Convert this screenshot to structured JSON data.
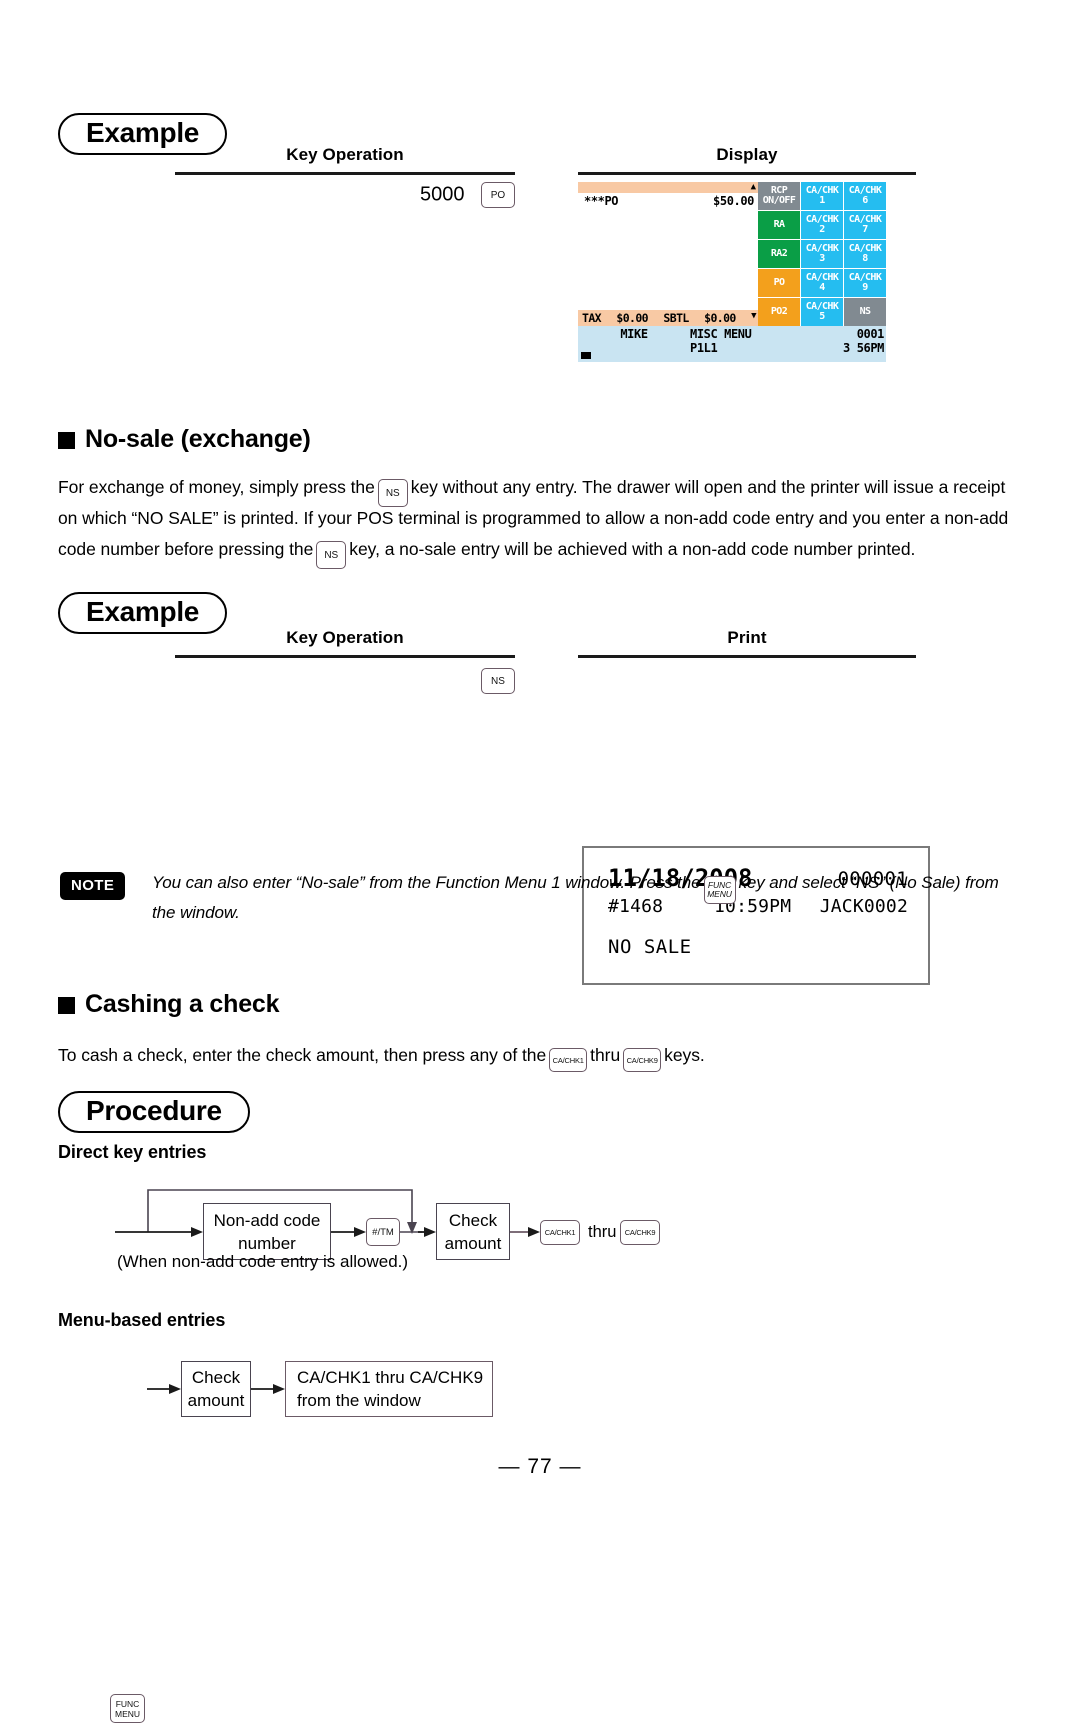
{
  "example1": {
    "pill_label": "Example",
    "key_operation_header": "Key Operation",
    "display_header": "Display",
    "entry_amount": "5000",
    "entry_key": "PO"
  },
  "pos_display": {
    "item_label": "***PO",
    "item_amount": "$50.00",
    "tax_label": "TAX",
    "tax_amount": "$0.00",
    "subtotal_label": "SBTL",
    "subtotal_amount": "$0.00",
    "up_arrow": "▲",
    "down_arrow": "▼",
    "clerk": "MIKE",
    "menu_name": "MISC MENU",
    "counter": "0001",
    "page_line": "P1L1",
    "time": "3 56PM",
    "keys": [
      {
        "line1": "RCP",
        "line2": "ON/OFF",
        "color": "gray"
      },
      {
        "line1": "CA/CHK",
        "line2": "1",
        "color": "cyan"
      },
      {
        "line1": "CA/CHK",
        "line2": "6",
        "color": "cyan"
      },
      {
        "line1": "RA",
        "line2": "",
        "color": "green"
      },
      {
        "line1": "CA/CHK",
        "line2": "2",
        "color": "cyan"
      },
      {
        "line1": "CA/CHK",
        "line2": "7",
        "color": "cyan"
      },
      {
        "line1": "RA2",
        "line2": "",
        "color": "green"
      },
      {
        "line1": "CA/CHK",
        "line2": "3",
        "color": "cyan"
      },
      {
        "line1": "CA/CHK",
        "line2": "8",
        "color": "cyan"
      },
      {
        "line1": "PO",
        "line2": "",
        "color": "orange"
      },
      {
        "line1": "CA/CHK",
        "line2": "4",
        "color": "cyan"
      },
      {
        "line1": "CA/CHK",
        "line2": "9",
        "color": "cyan"
      },
      {
        "line1": "PO2",
        "line2": "",
        "color": "orange"
      },
      {
        "line1": "CA/CHK",
        "line2": "5",
        "color": "cyan"
      },
      {
        "line1": "NS",
        "line2": "",
        "color": "gray"
      }
    ],
    "colors": {
      "gray": "#818a91",
      "green": "#0a9e46",
      "orange": "#f3a01c",
      "cyan": "#25bdf0",
      "peach": "#f8c9a4",
      "status_blue": "#c9e4f2"
    }
  },
  "no_sale_section": {
    "heading": "No-sale (exchange)",
    "para_part1": "For exchange of money, simply press the",
    "key1": "NS",
    "para_part2": "key without any entry. The drawer will open and the printer will issue a receipt on which “NO SALE” is printed. If your POS terminal is programmed to allow a non-add code entry and you enter a non-add code number before pressing the",
    "key2": "NS",
    "para_part3": "key, a no-sale entry will be achieved with a non-add code number printed."
  },
  "example2": {
    "pill_label": "Example",
    "key_operation_header": "Key Operation",
    "print_header": "Print",
    "entry_key": "NS"
  },
  "receipt": {
    "date": "11/18/2008",
    "receipt_no": "000001",
    "machine_no": "#1468",
    "time": "10:59PM",
    "clerk": "JACK0002",
    "message": "NO SALE"
  },
  "note": {
    "badge": "NOTE",
    "text_part1": "You can also enter “No-sale” from the Function Menu 1 window. Press the",
    "key_line1": "FUNC",
    "key_line2": "MENU",
    "text_part2": "key and select “NS” (No Sale)  from the window."
  },
  "cashing_section": {
    "heading": "Cashing a check",
    "para_part1": "To cash a check, enter the check amount, then press any of the",
    "key1": "CA/CHK1",
    "para_part2": "thru",
    "key2": "CA/CHK9",
    "para_part3": "keys.",
    "procedure_pill": "Procedure"
  },
  "direct_entries": {
    "sub_heading": "Direct key entries",
    "box_nonadd_line1": "Non-add code",
    "box_nonadd_line2": "number",
    "key_tm": "#/TM",
    "box_check_line1": "Check",
    "box_check_line2": "amount",
    "key_cachk1": "CA/CHK1",
    "thru_label": "thru",
    "key_cachk9": "CA/CHK9",
    "footnote": "(When non-add code entry is allowed.)"
  },
  "menu_entries": {
    "sub_heading": "Menu-based entries",
    "key_func_line1": "FUNC",
    "key_func_line2": "MENU",
    "box_check_line1": "Check",
    "box_check_line2": "amount",
    "box_window_line1": "CA/CHK1 thru CA/CHK9",
    "box_window_line2": "from the window"
  },
  "footer": {
    "page_number": "— 77 —"
  }
}
